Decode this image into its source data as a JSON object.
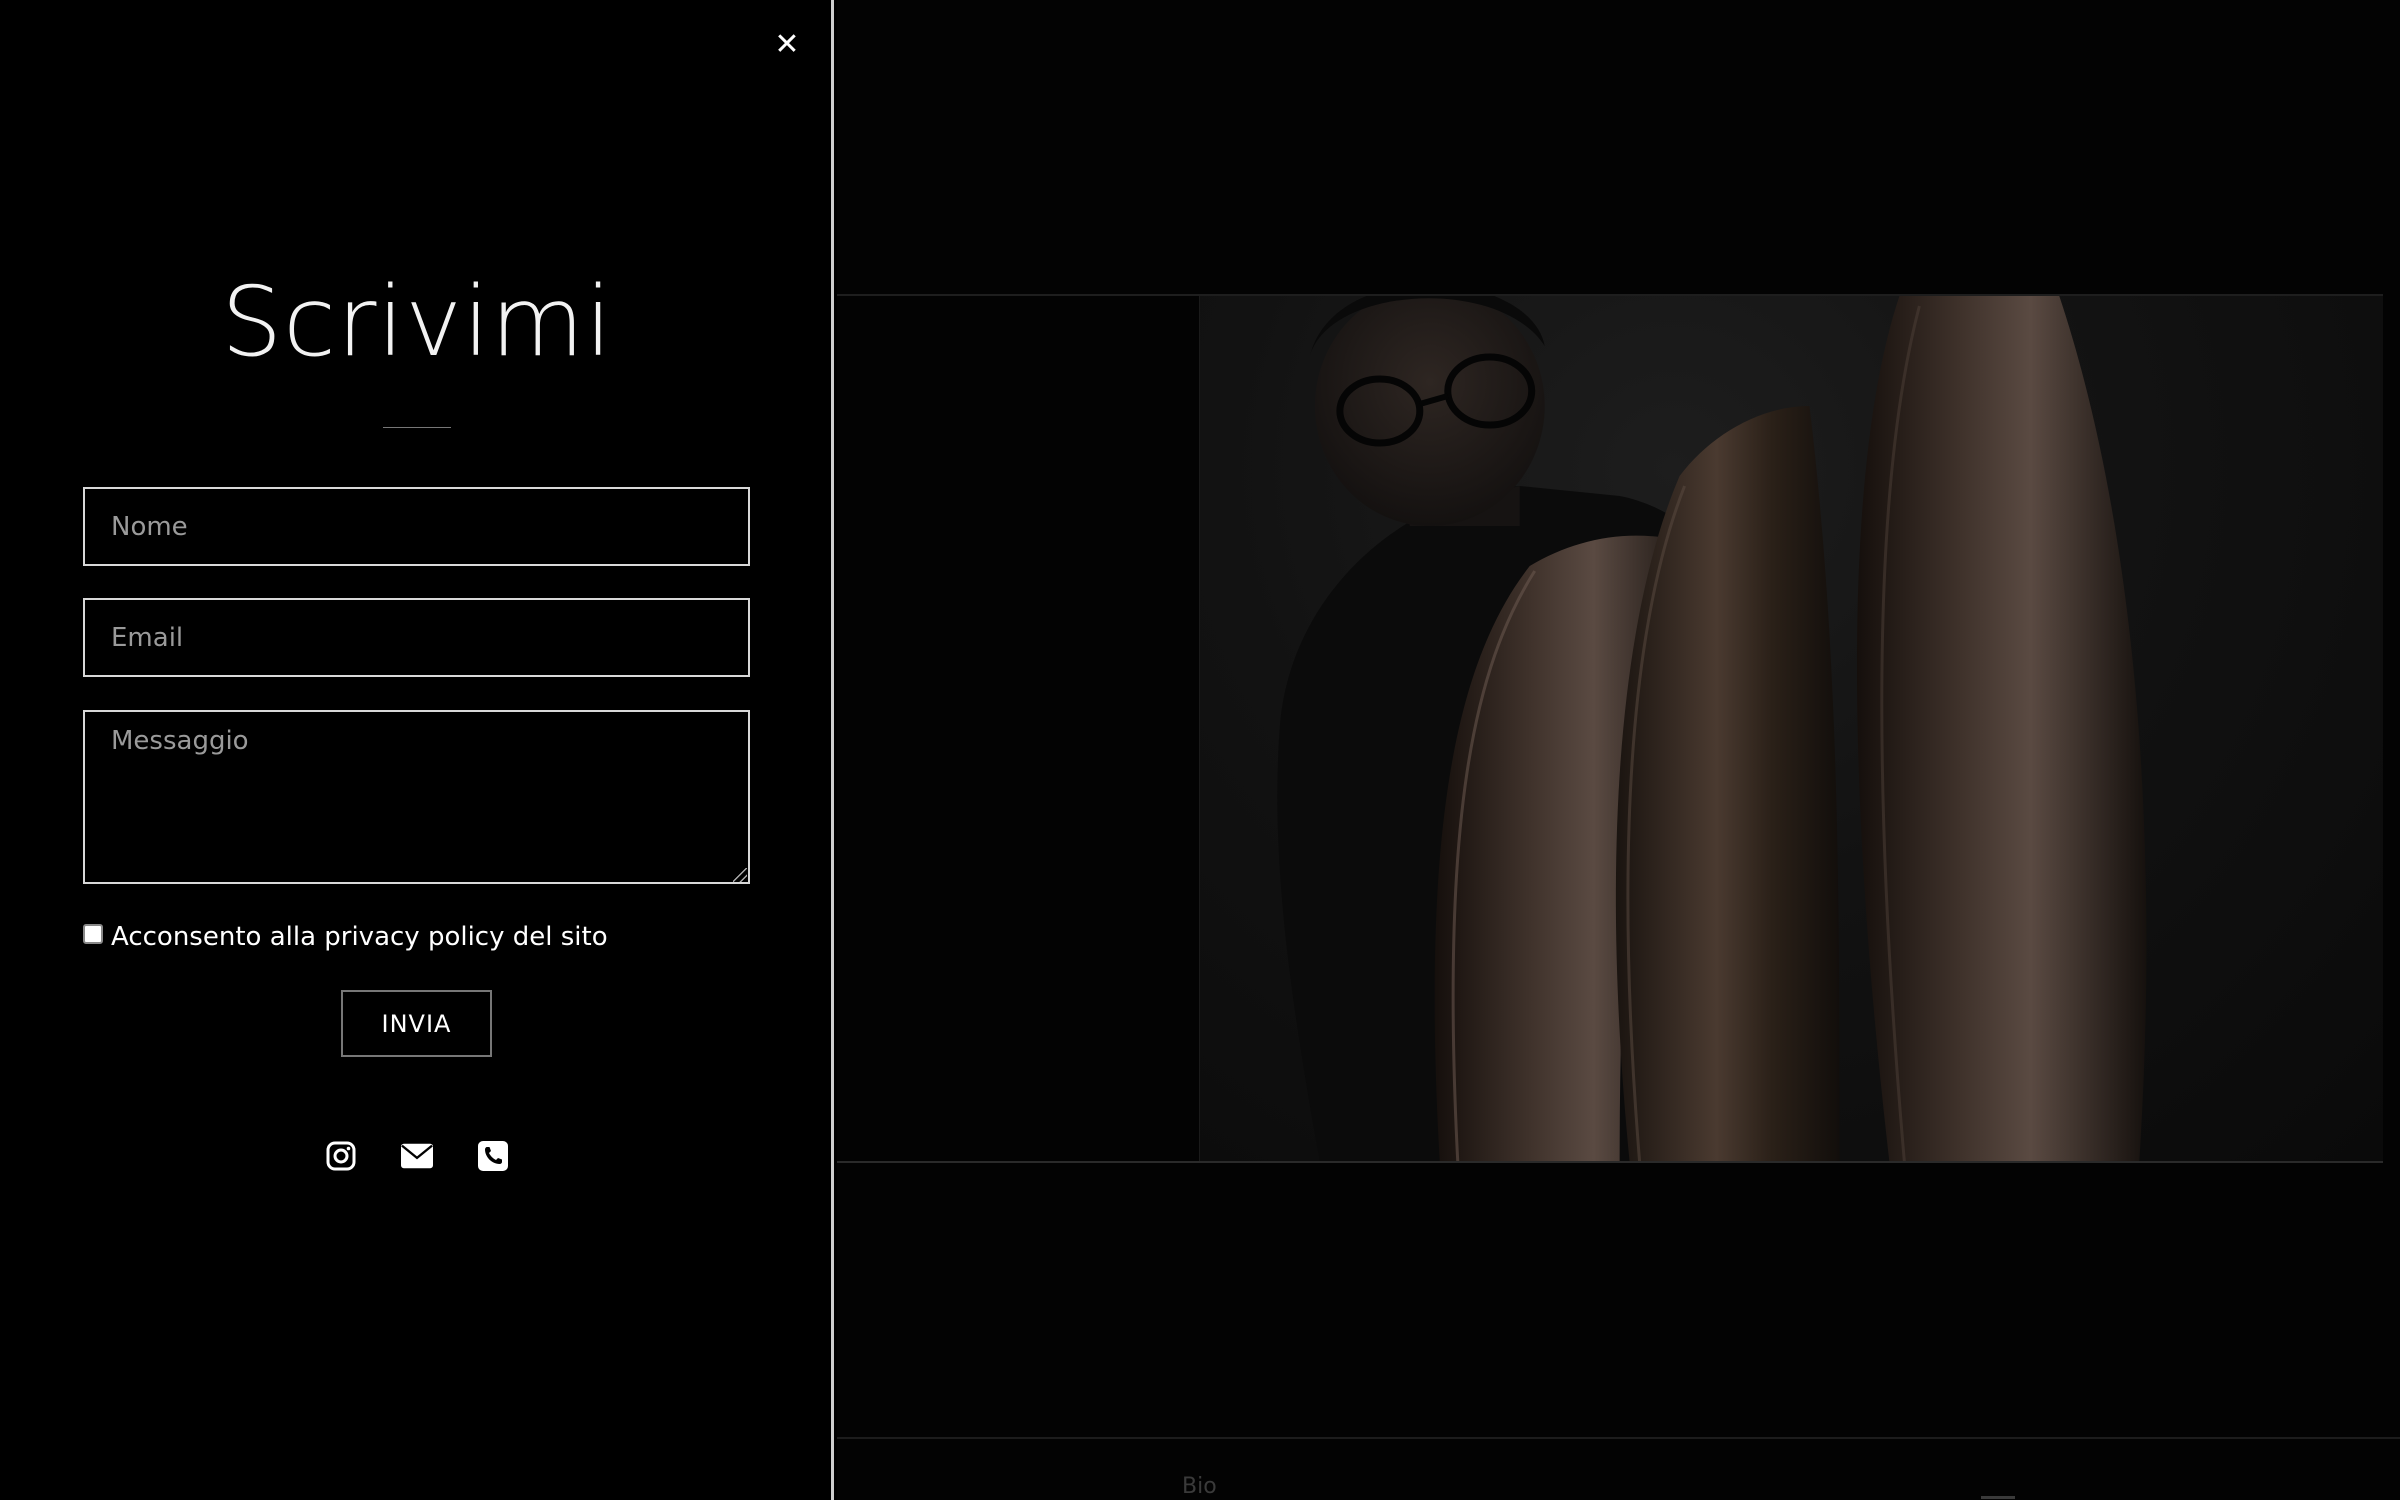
{
  "contact": {
    "close_symbol": "✕",
    "title": "Scrivimi",
    "fields": {
      "name_placeholder": "Nome",
      "email_placeholder": "Email",
      "message_placeholder": "Messaggio"
    },
    "consent_label": "Acconsento alla privacy policy del sito",
    "submit_label": "INVIA",
    "social_icons": [
      "instagram-icon",
      "envelope-icon",
      "phone-icon"
    ]
  },
  "background_page": {
    "footer_link": "Bio"
  },
  "colors": {
    "background": "#000000",
    "text": "#ffffff",
    "field_border": "#d8d8d8",
    "placeholder": "#9a9a9a"
  }
}
